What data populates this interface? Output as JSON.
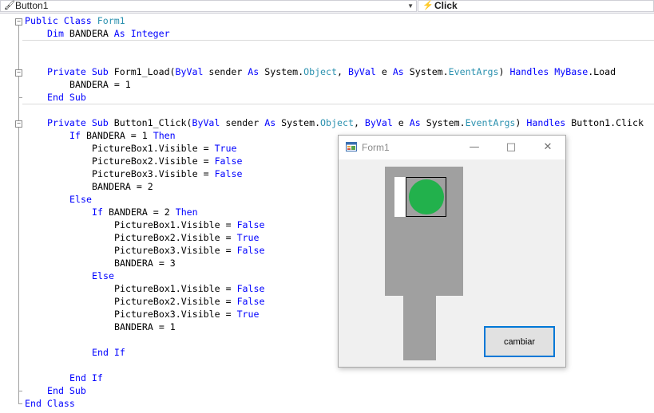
{
  "navbar": {
    "object_selector": "Button1",
    "event_selector": "Click"
  },
  "code": {
    "lines": [
      [
        "Public Class Form1"
      ],
      [
        "Dim BANDERA As Integer"
      ],
      [
        "Private Sub Form1_Load(ByVal sender As System.Object, ByVal e As System.EventArgs) Handles MyBase.Load"
      ],
      [
        "BANDERA = 1"
      ],
      [
        "End Sub"
      ],
      [
        "Private Sub Button1_Click(ByVal sender As System.Object, ByVal e As System.EventArgs) Handles Button1.Click"
      ],
      [
        "If BANDERA = 1 Then"
      ],
      [
        "PictureBox1.Visible = True"
      ],
      [
        "PictureBox2.Visible = False"
      ],
      [
        "PictureBox3.Visible = False"
      ],
      [
        "BANDERA = 2"
      ],
      [
        "Else"
      ],
      [
        "If BANDERA = 2 Then"
      ],
      [
        "PictureBox1.Visible = False"
      ],
      [
        "PictureBox2.Visible = True"
      ],
      [
        "PictureBox3.Visible = False"
      ],
      [
        "BANDERA = 3"
      ],
      [
        "Else"
      ],
      [
        "PictureBox1.Visible = False"
      ],
      [
        "PictureBox2.Visible = False"
      ],
      [
        "PictureBox3.Visible = True"
      ],
      [
        "BANDERA = 1"
      ],
      [
        "End If"
      ],
      [
        "End If"
      ],
      [
        "End Sub"
      ],
      [
        "End Class"
      ]
    ]
  },
  "form_window": {
    "title": "Form1",
    "button_label": "cambiar",
    "light_color": "#22b14c",
    "panel_color": "#a0a0a0"
  },
  "colors": {
    "keyword": "#0000ff",
    "type": "#2b91af",
    "accent": "#0078d7"
  }
}
